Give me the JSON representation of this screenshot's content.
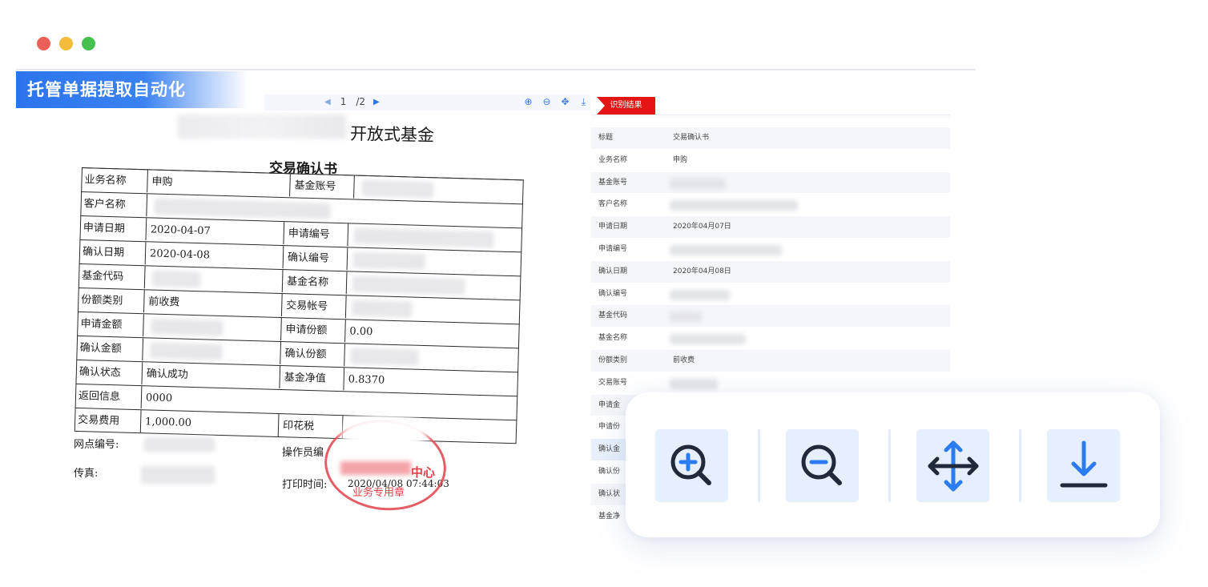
{
  "window": {
    "controls": [
      "close",
      "minimize",
      "maximize"
    ]
  },
  "banner": {
    "title": "托管单据提取自动化"
  },
  "viewer": {
    "page_current": "1",
    "page_total": "/2",
    "prev_icon": "chevron-left-icon",
    "next_icon": "chevron-right-icon",
    "tools": [
      "zoom-in-icon",
      "zoom-out-icon",
      "move-icon",
      "download-icon"
    ]
  },
  "document": {
    "title": "开放式基金",
    "subtitle": "交易确认书",
    "labels": {
      "business_name": "业务名称",
      "fund_account": "基金账号",
      "customer_name": "客户名称",
      "apply_date": "申请日期",
      "apply_no": "申请编号",
      "confirm_date": "确认日期",
      "confirm_no": "确认编号",
      "fund_code": "基金代码",
      "fund_name": "基金名称",
      "share_type": "份额类别",
      "trade_account": "交易帐号",
      "apply_amount": "申请金额",
      "apply_shares": "申请份额",
      "confirm_amount": "确认金额",
      "confirm_shares": "确认份额",
      "confirm_status": "确认状态",
      "nav": "基金净值",
      "return_info": "返回信息",
      "trade_fee": "交易费用",
      "stamp_tax": "印花税",
      "branch_no": "网点编号:",
      "operator": "操作员编",
      "fax": "传真:",
      "print_time": "打印时间:"
    },
    "values": {
      "business_name": "申购",
      "apply_date": "2020-04-07",
      "confirm_date": "2020-04-08",
      "share_type": "前收费",
      "apply_shares": "0.00",
      "confirm_status": "确认成功",
      "nav": "0.8370",
      "return_info": "0000",
      "trade_fee": "1,000.00",
      "print_time": "2020/04/08 07:44:03"
    },
    "stamp": {
      "text_main": "中心",
      "text_sub": "业务专用章",
      "color": "#e0424a"
    }
  },
  "result": {
    "tab_label": "识别结果",
    "rows": [
      {
        "key": "标题",
        "value": "交易确认书"
      },
      {
        "key": "业务名称",
        "value": "申购"
      },
      {
        "key": "基金账号",
        "value": ""
      },
      {
        "key": "客户名称",
        "value": ""
      },
      {
        "key": "申请日期",
        "value": "2020年04月07日"
      },
      {
        "key": "申请编号",
        "value": ""
      },
      {
        "key": "确认日期",
        "value": "2020年04月08日"
      },
      {
        "key": "确认编号",
        "value": ""
      },
      {
        "key": "基金代码",
        "value": ""
      },
      {
        "key": "基金名称",
        "value": ""
      },
      {
        "key": "份额类别",
        "value": "前收费"
      },
      {
        "key": "交易账号",
        "value": ""
      },
      {
        "key": "申请金",
        "value": ""
      },
      {
        "key": "申请份",
        "value": ""
      },
      {
        "key": "确认金",
        "value": ""
      },
      {
        "key": "确认份",
        "value": ""
      },
      {
        "key": "确认状",
        "value": ""
      },
      {
        "key": "基金净",
        "value": ""
      }
    ]
  },
  "tool_card": {
    "buttons": [
      {
        "name": "zoom-in-button",
        "icon": "zoom-in-icon"
      },
      {
        "name": "zoom-out-button",
        "icon": "zoom-out-icon"
      },
      {
        "name": "move-button",
        "icon": "move-icon"
      },
      {
        "name": "download-button",
        "icon": "download-icon"
      }
    ],
    "icon_dark": "#1f2a3c",
    "icon_blue": "#2b7cf0"
  }
}
